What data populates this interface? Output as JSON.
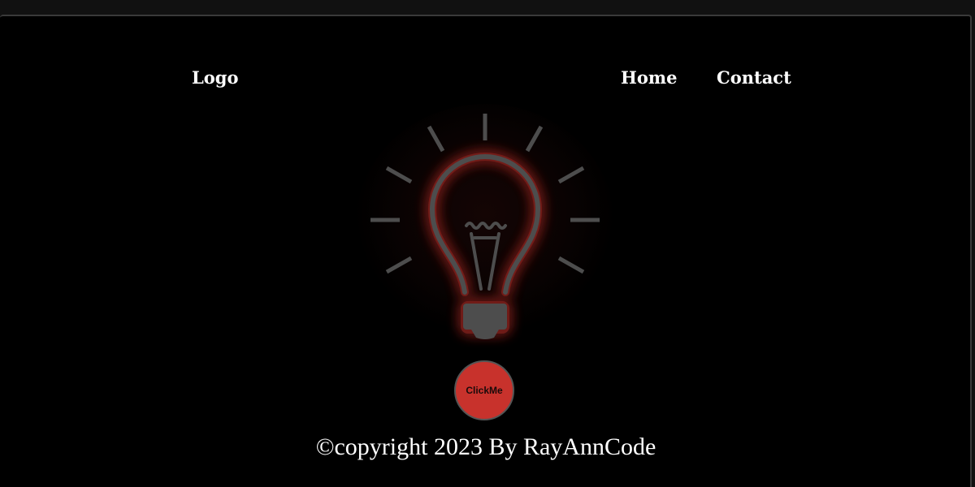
{
  "nav": {
    "logo": "Logo",
    "links": [
      {
        "label": "Home"
      },
      {
        "label": "Contact"
      }
    ]
  },
  "hero": {
    "icon": "lightbulb-icon",
    "state": "off",
    "glow_color": "#c8322c",
    "stroke_color": "#4d4d4d"
  },
  "button": {
    "label": "ClickMe",
    "color": "#c8322c"
  },
  "footer": {
    "copyright": "©copyright 2023 By RayAnnCode"
  }
}
